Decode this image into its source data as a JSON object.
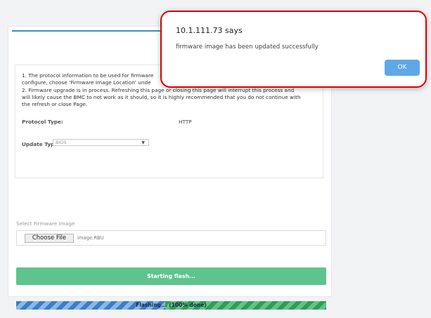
{
  "dialog": {
    "title": "10.1.111.73 says",
    "message": "firmware image has been updated successfully",
    "ok_label": "OK"
  },
  "info": {
    "para1_line1": "1. The protocol information to be used for firmware",
    "para1_line2": "configure, choose 'Firmware Image Location' unde",
    "para2_line1": "2. Firmware upgrade is in process. Refreshing this page or closing this page will interrupt this process and",
    "para2_line2": "will likely cause the BMC to not work as it should, so it is highly recommended that you do not continue with",
    "para2_line3": "the refresh or close Page.",
    "protocol_label": "Protocol Type:",
    "protocol_value": "HTTP",
    "update_label": "Update Type:",
    "update_value": "BIOS"
  },
  "firmware": {
    "label": "Select Firmware Image",
    "choose_label": "Choose File",
    "file_name": "image.RBU"
  },
  "actions": {
    "flash_label": "Starting flash..."
  },
  "progress": {
    "label": "Flashing... (100% done)",
    "percent": 100
  },
  "colors": {
    "accent": "#3c8dbc",
    "flash_button": "#5fc38e",
    "dialog_border": "#e00000",
    "ok_button": "#5ea8e8"
  },
  "icons": {
    "dropdown": "chevron-down-icon"
  }
}
